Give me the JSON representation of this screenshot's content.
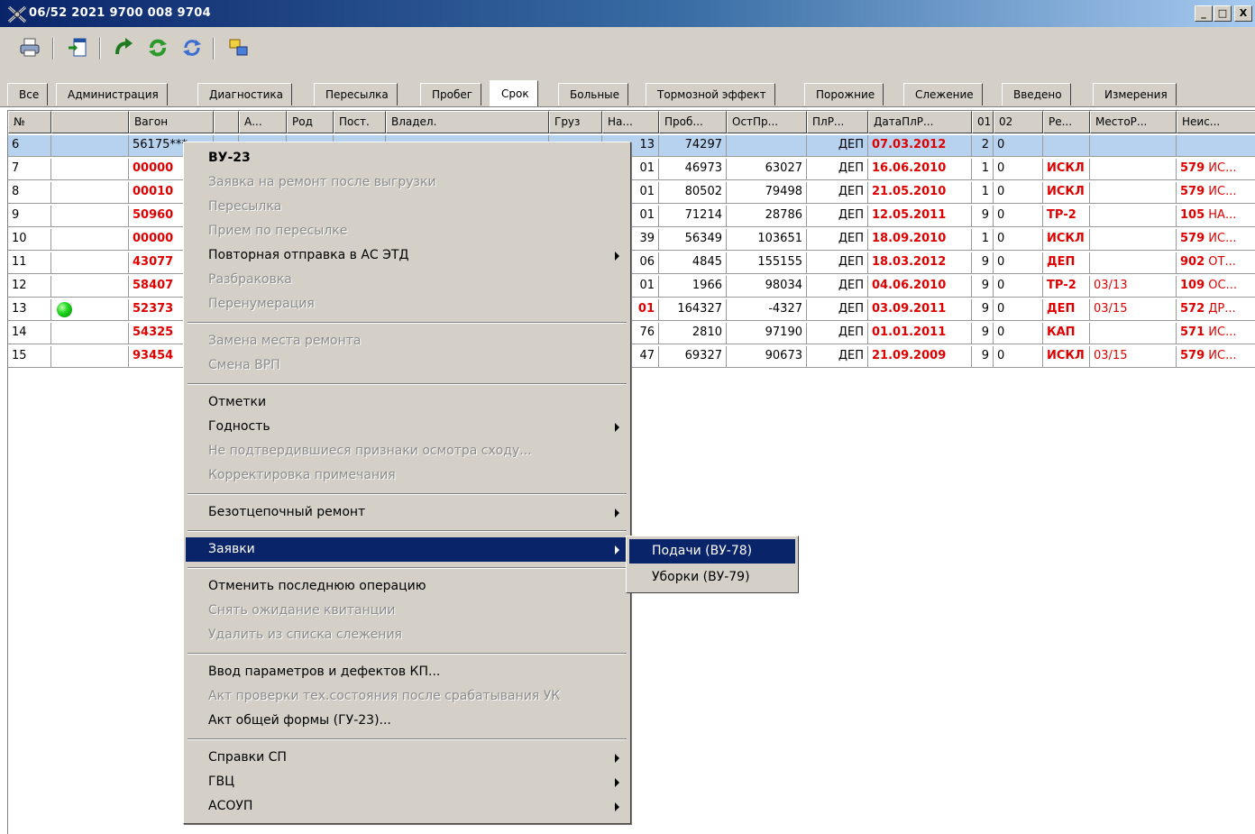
{
  "window": {
    "title": "06/52 2021  9700 008 9704",
    "minimize": "_",
    "maximize": "□",
    "close": "X"
  },
  "toolbar": {
    "buttons": [
      "print-icon",
      "import-icon",
      "redo-icon",
      "refresh-green-icon",
      "refresh-blue-icon",
      "windows-icon"
    ]
  },
  "tabs": [
    "Все",
    "Администрация",
    "Диагностика",
    "Пересылка",
    "Пробег",
    "Срок",
    "Больные",
    "Тормозной эффект",
    "Порожние",
    "Слежение",
    "Введено",
    "Измерения"
  ],
  "active_tab": "Срок",
  "table": {
    "columns": [
      "№",
      "",
      "Вагон",
      "",
      "А...",
      "Род",
      "Пост.",
      "Владел.",
      "Груз",
      "На...",
      "Проб...",
      "ОстПр...",
      "ПлР...",
      "ДатаПлР...",
      "01",
      "02",
      "Ре...",
      "МестоР...",
      "Неис..."
    ],
    "rows": [
      {
        "n": "6",
        "dot": false,
        "wagon": "56175***",
        "na": "13",
        "prob": "74297",
        "ost": "",
        "plr": "ДЕП",
        "date": "07.03.2012",
        "c01": "2",
        "c02": "0",
        "re": "",
        "mesto": "",
        "neis_num": "",
        "neis_txt": ""
      },
      {
        "n": "7",
        "dot": false,
        "wagon": "00000",
        "na": "01",
        "prob": "46973",
        "ost": "63027",
        "plr": "ДЕП",
        "date": "16.06.2010",
        "c01": "1",
        "c02": "0",
        "re": "ИСКЛ",
        "mesto": "",
        "neis_num": "579",
        "neis_txt": " ИС..."
      },
      {
        "n": "8",
        "dot": false,
        "wagon": "00010",
        "na": "01",
        "prob": "80502",
        "ost": "79498",
        "plr": "ДЕП",
        "date": "21.05.2010",
        "c01": "1",
        "c02": "0",
        "re": "ИСКЛ",
        "mesto": "",
        "neis_num": "579",
        "neis_txt": " ИС..."
      },
      {
        "n": "9",
        "dot": false,
        "wagon": "50960",
        "na": "01",
        "prob": "71214",
        "ost": "28786",
        "plr": "ДЕП",
        "date": "12.05.2011",
        "c01": "9",
        "c02": "0",
        "re": "ТР-2",
        "mesto": "",
        "neis_num": "105",
        "neis_txt": " НА..."
      },
      {
        "n": "10",
        "dot": false,
        "wagon": "00000",
        "na": "39",
        "prob": "56349",
        "ost": "103651",
        "plr": "ДЕП",
        "date": "18.09.2010",
        "c01": "1",
        "c02": "0",
        "re": "ИСКЛ",
        "mesto": "",
        "neis_num": "579",
        "neis_txt": " ИС..."
      },
      {
        "n": "11",
        "dot": false,
        "wagon": "43077",
        "na": "06",
        "prob": "4845",
        "ost": "155155",
        "plr": "ДЕП",
        "date": "18.03.2012",
        "c01": "9",
        "c02": "0",
        "re": "ДЕП",
        "mesto": "",
        "neis_num": "902",
        "neis_txt": " ОТ..."
      },
      {
        "n": "12",
        "dot": false,
        "wagon": "58407",
        "na": "01",
        "prob": "1966",
        "ost": "98034",
        "plr": "ДЕП",
        "date": "04.06.2010",
        "c01": "9",
        "c02": "0",
        "re": "ТР-2",
        "mesto": "03/13",
        "neis_num": "109",
        "neis_txt": " ОС..."
      },
      {
        "n": "13",
        "dot": true,
        "wagon": "52373",
        "na": "01",
        "prob": "164327",
        "ost": "-4327",
        "plr": "ДЕП",
        "date": "03.09.2011",
        "c01": "9",
        "c02": "0",
        "re": "ДЕП",
        "mesto": "03/15",
        "neis_num": "572",
        "neis_txt": " ДР..."
      },
      {
        "n": "14",
        "dot": false,
        "wagon": "54325",
        "na": "76",
        "prob": "2810",
        "ost": "97190",
        "plr": "ДЕП",
        "date": "01.01.2011",
        "c01": "9",
        "c02": "0",
        "re": "КАП",
        "mesto": "",
        "neis_num": "571",
        "neis_txt": " ИС..."
      },
      {
        "n": "15",
        "dot": false,
        "wagon": "93454",
        "na": "47",
        "prob": "69327",
        "ost": "90673",
        "plr": "ДЕП",
        "date": "21.09.2009",
        "c01": "9",
        "c02": "0",
        "re": "ИСКЛ",
        "mesto": "03/15",
        "neis_num": "579",
        "neis_txt": " ИС..."
      }
    ]
  },
  "context_menu": {
    "items": [
      {
        "label": "ВУ-23",
        "state": "bold"
      },
      {
        "label": "Заявка на ремонт после выгрузки",
        "state": "disabled"
      },
      {
        "label": "Пересылка",
        "state": "disabled"
      },
      {
        "label": "Прием по пересылке",
        "state": "disabled"
      },
      {
        "label": "Повторная отправка в АС ЭТД",
        "state": "normal",
        "submenu": true
      },
      {
        "label": "Разбраковка",
        "state": "disabled"
      },
      {
        "label": "Перенумерация",
        "state": "disabled"
      },
      {
        "sep": true
      },
      {
        "label": "Замена места ремонта",
        "state": "disabled"
      },
      {
        "label": "Смена ВРП",
        "state": "disabled"
      },
      {
        "sep": true
      },
      {
        "label": "Отметки",
        "state": "normal"
      },
      {
        "label": "Годность",
        "state": "normal",
        "submenu": true
      },
      {
        "label": "Не подтвердившиеся признаки осмотра сходу...",
        "state": "disabled"
      },
      {
        "label": "Корректировка примечания",
        "state": "disabled"
      },
      {
        "sep": true
      },
      {
        "label": "Безотцепочный ремонт",
        "state": "normal",
        "submenu": true
      },
      {
        "sep": true
      },
      {
        "label": "Заявки",
        "state": "highlighted",
        "submenu": true
      },
      {
        "sep": true
      },
      {
        "label": "Отменить последнюю операцию",
        "state": "normal"
      },
      {
        "label": "Снять ожидание квитанции",
        "state": "disabled"
      },
      {
        "label": "Удалить из списка слежения",
        "state": "disabled"
      },
      {
        "sep": true
      },
      {
        "label": "Ввод параметров и дефектов КП...",
        "state": "normal"
      },
      {
        "label": "Акт проверки тех.состояния после срабатывания УК",
        "state": "disabled"
      },
      {
        "label": "Акт общей формы (ГУ-23)...",
        "state": "normal"
      },
      {
        "sep": true
      },
      {
        "label": "Справки СП",
        "state": "normal",
        "submenu": true
      },
      {
        "label": "ГВЦ",
        "state": "normal",
        "submenu": true
      },
      {
        "label": "АСОУП",
        "state": "normal",
        "submenu": true
      }
    ]
  },
  "submenu": {
    "items": [
      {
        "label": "Подачи (ВУ-78)",
        "state": "highlighted"
      },
      {
        "label": "Уборки (ВУ-79)",
        "state": "normal"
      }
    ]
  },
  "colors": {
    "selection": "#b7d2ee",
    "menu_highlight": "#0a246a",
    "alert_red": "#e00000",
    "chrome": "#d4d0c8"
  }
}
